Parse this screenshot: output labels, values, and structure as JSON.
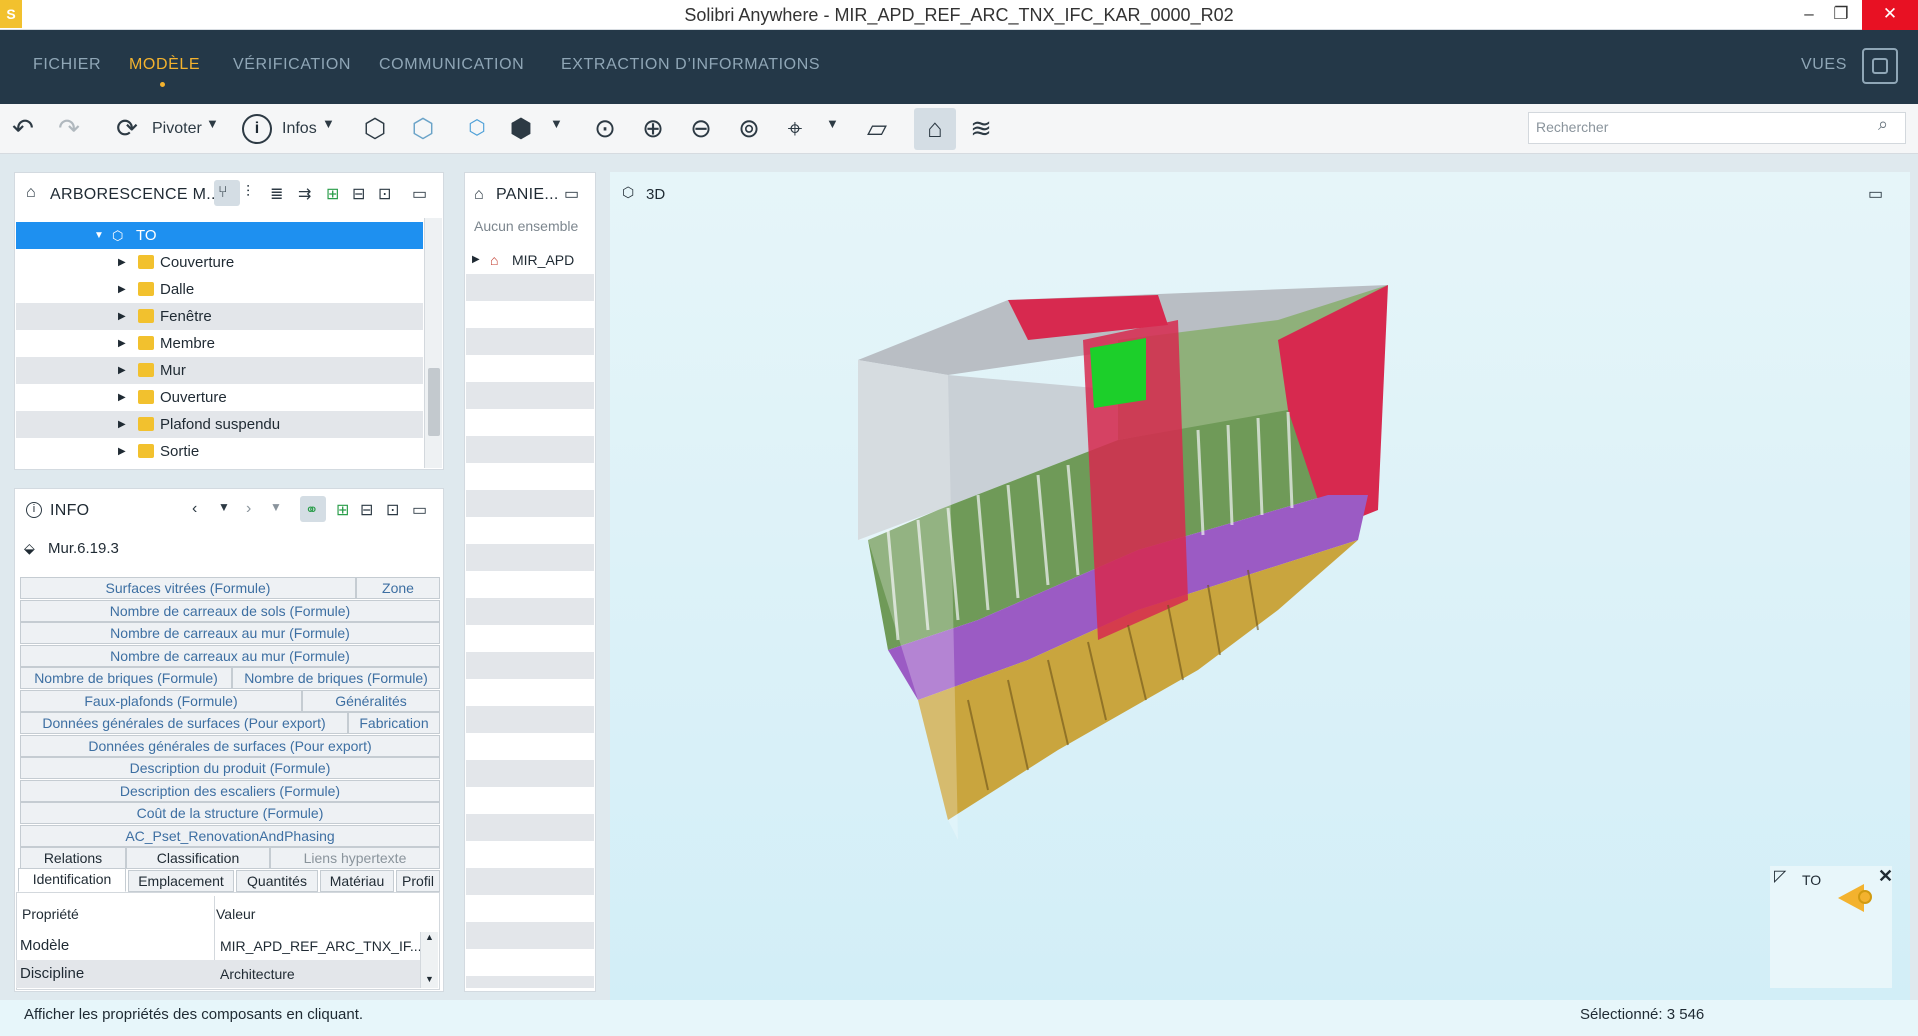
{
  "window": {
    "title": "Solibri Anywhere - MIR_APD_REF_ARC_TNX_IFC_KAR_0000_R02",
    "logo": "S",
    "minimize": "–",
    "maximize": "❐",
    "close": "✕"
  },
  "menu": {
    "items": [
      "FICHIER",
      "MODÈLE",
      "VÉRIFICATION",
      "COMMUNICATION",
      "EXTRACTION D’INFORMATIONS"
    ],
    "active": "MODÈLE",
    "views": "VUES"
  },
  "toolbar": {
    "rotate_label": "Pivoter",
    "info_label": "Infos",
    "search_placeholder": "Rechercher"
  },
  "tree_panel": {
    "title": "ARBORESCENCE M...",
    "selected": "TO",
    "items": [
      "Couverture",
      "Dalle",
      "Fenêtre",
      "Membre",
      "Mur",
      "Ouverture",
      "Plafond suspendu",
      "Sortie"
    ]
  },
  "basket_panel": {
    "title": "PANIE...",
    "empty_text": "Aucun ensemble",
    "item": "MIR_APD"
  },
  "info_panel": {
    "title": "INFO",
    "component": "Mur.6.19.3",
    "property_tabs": [
      [
        "Surfaces vitrées (Formule)",
        "Zone"
      ],
      [
        "Nombre de carreaux de sols (Formule)"
      ],
      [
        "Nombre de carreaux au mur (Formule)"
      ],
      [
        "Nombre de carreaux au mur (Formule)"
      ],
      [
        "Nombre de briques (Formule)",
        "Nombre de briques (Formule)"
      ],
      [
        "Faux-plafonds (Formule)",
        "Généralités"
      ],
      [
        "Données générales de surfaces (Pour export)",
        "Fabrication"
      ],
      [
        "Données générales de surfaces (Pour export)"
      ],
      [
        "Description du produit (Formule)"
      ],
      [
        "Description des escaliers (Formule)"
      ],
      [
        "Coût de la structure (Formule)"
      ],
      [
        "AC_Pset_RenovationAndPhasing"
      ]
    ],
    "tabs_row1": [
      "Relations",
      "Classification",
      "Liens hypertexte"
    ],
    "tabs_row2": [
      "Identification",
      "Emplacement",
      "Quantités",
      "Matériau",
      "Profil"
    ],
    "col_property": "Propriété",
    "col_value": "Valeur",
    "rows": [
      {
        "property": "Modèle",
        "value": "MIR_APD_REF_ARC_TNX_IF..."
      },
      {
        "property": "Discipline",
        "value": "Architecture"
      }
    ]
  },
  "viewport": {
    "title": "3D",
    "minimap_label": "TO"
  },
  "status": {
    "hint": "Afficher les propriétés des composants en cliquant.",
    "selected": "Sélectionné: 3 546"
  }
}
